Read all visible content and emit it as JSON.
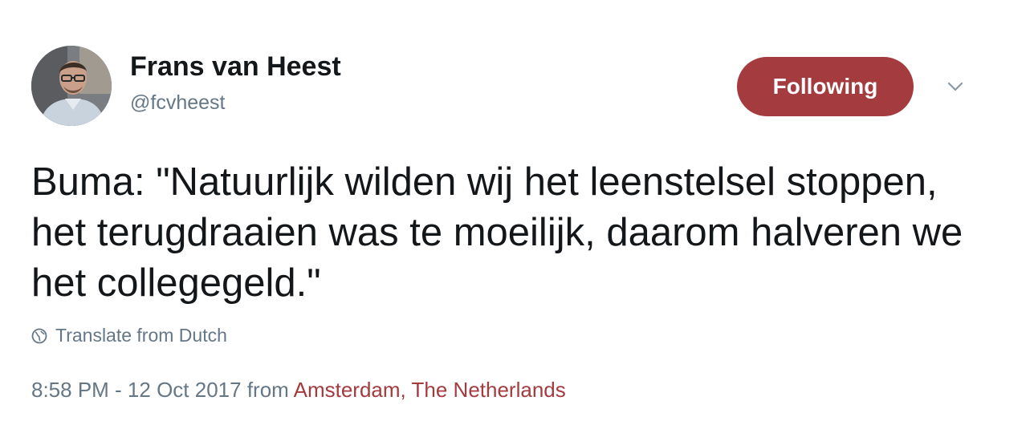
{
  "author": {
    "display_name": "Frans van Heest",
    "handle": "@fcvheest",
    "avatar_icon": "user-avatar-photo"
  },
  "actions": {
    "follow_label": "Following",
    "follow_color": "#a43b3f",
    "caret_icon": "chevron-down-icon"
  },
  "tweet": {
    "text": "Buma: \"Natuurlijk wilden wij het leenstelsel stoppen, het terugdraaien was te moeilijk, daarom halveren we het collegegeld.\"",
    "translate_label": "Translate from Dutch",
    "translate_icon": "globe-icon"
  },
  "meta": {
    "timestamp": "8:58 PM - 12 Oct 2017",
    "from_label": "from",
    "location": "Amsterdam, The Netherlands",
    "location_color": "#a43b3f"
  }
}
